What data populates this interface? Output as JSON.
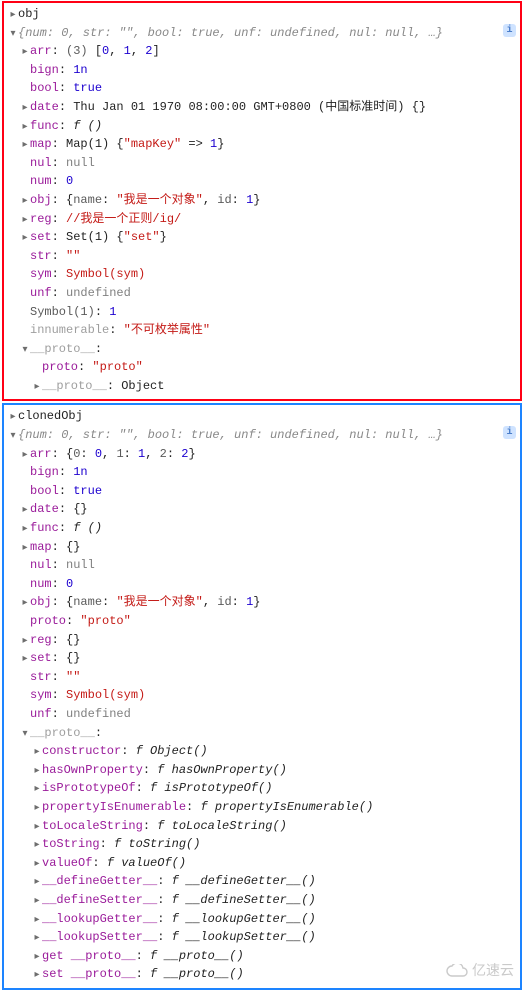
{
  "obj": {
    "name": "obj",
    "summary": "{num: 0, str: \"\", bool: true, unf: undefined, nul: null, …}",
    "arr_count": "(3)",
    "arr_vals": "[0, 1, 2]",
    "bign": "1n",
    "bool": "true",
    "date_text": "Thu Jan 01 1970 08:00:00 GMT+0800 (中国标准时间) {}",
    "func": "f ()",
    "map_text": "Map(1) {\"mapKey\" => 1}",
    "nul": "null",
    "num": "0",
    "obj_name": "我是一个对象",
    "obj_id": "1",
    "reg": "/我是一个正则/ig/",
    "set_text": "Set(1) {\"set\"}",
    "str": "\"\"",
    "sym": "Symbol(sym)",
    "unf": "undefined",
    "symbol1": "Symbol(1)",
    "symbol1_val": "1",
    "innumerable_val": "不可枚举属性",
    "proto_label": "__proto__",
    "proto_val": "proto",
    "proto_proto_val": "Object"
  },
  "clonedObj": {
    "name": "clonedObj",
    "summary": "{num: 0, str: \"\", bool: true, unf: undefined, nul: null, …}",
    "arr_text": "{0: 0, 1: 1, 2: 2}",
    "bign": "1n",
    "bool": "true",
    "date_text": "{}",
    "func": "f ()",
    "map_text": "{}",
    "nul": "null",
    "num": "0",
    "obj_name": "我是一个对象",
    "obj_id": "1",
    "proto_val": "proto",
    "reg_text": "{}",
    "set_text": "{}",
    "str": "\"\"",
    "sym": "Symbol(sym)",
    "unf": "undefined",
    "proto_label": "__proto__",
    "proto_methods": [
      {
        "k": "constructor",
        "v": "f Object()"
      },
      {
        "k": "hasOwnProperty",
        "v": "f hasOwnProperty()"
      },
      {
        "k": "isPrototypeOf",
        "v": "f isPrototypeOf()"
      },
      {
        "k": "propertyIsEnumerable",
        "v": "f propertyIsEnumerable()"
      },
      {
        "k": "toLocaleString",
        "v": "f toLocaleString()"
      },
      {
        "k": "toString",
        "v": "f toString()"
      },
      {
        "k": "valueOf",
        "v": "f valueOf()"
      },
      {
        "k": "__defineGetter__",
        "v": "f __defineGetter__()"
      },
      {
        "k": "__defineSetter__",
        "v": "f __defineSetter__()"
      },
      {
        "k": "__lookupGetter__",
        "v": "f __lookupGetter__()"
      },
      {
        "k": "__lookupSetter__",
        "v": "f __lookupSetter__()"
      },
      {
        "k": "get __proto__",
        "v": "f __proto__()"
      },
      {
        "k": "set __proto__",
        "v": "f __proto__()"
      }
    ]
  },
  "watermark": "亿速云",
  "labels": {
    "arr": "arr",
    "bign": "bign",
    "bool": "bool",
    "date": "date",
    "func": "func",
    "map": "map",
    "nul": "nul",
    "num": "num",
    "obj": "obj",
    "reg": "reg",
    "set": "set",
    "str": "str",
    "sym": "sym",
    "unf": "unf",
    "innumerable": "innumerable",
    "proto": "proto",
    "name": "name",
    "id": "id"
  }
}
